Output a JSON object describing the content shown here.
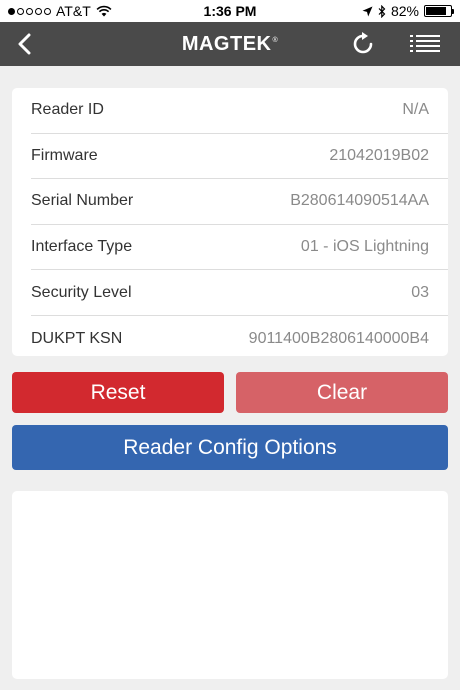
{
  "status_bar": {
    "carrier": "AT&T",
    "time": "1:36 PM",
    "battery": "82%",
    "battery_level": 0.82,
    "signal_bars_filled": 1,
    "signal_bars_total": 5
  },
  "nav": {
    "logo": "MAGTEK",
    "logo_mark": "®",
    "back_icon": "chevron-left-icon",
    "refresh_icon": "refresh-icon",
    "menu_icon": "list-menu-icon",
    "bar_color": "#4a4a4a"
  },
  "info": {
    "rows": [
      {
        "label": "Reader ID",
        "value": "N/A"
      },
      {
        "label": "Firmware",
        "value": "21042019B02"
      },
      {
        "label": "Serial Number",
        "value": "B280614090514AA"
      },
      {
        "label": "Interface Type",
        "value": "01 - iOS Lightning"
      },
      {
        "label": "Security Level",
        "value": "03"
      },
      {
        "label": "DUKPT KSN",
        "value": "9011400B2806140000B4"
      }
    ]
  },
  "buttons": {
    "reset_label": "Reset",
    "clear_label": "Clear",
    "config_label": "Reader Config Options",
    "reset_color": "#d2292f",
    "clear_color": "#d66267",
    "config_color": "#3466b0"
  },
  "output": {
    "text": ""
  }
}
